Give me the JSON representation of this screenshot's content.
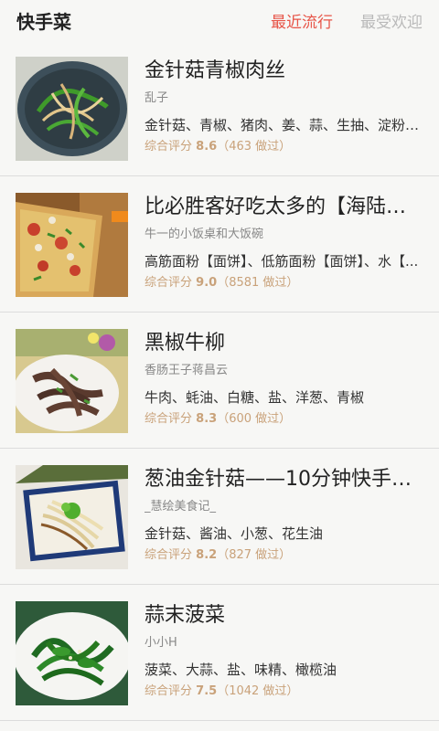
{
  "header": {
    "title": "快手菜",
    "tabs": [
      {
        "label": "最近流行",
        "active": true
      },
      {
        "label": "最受欢迎",
        "active": false
      }
    ]
  },
  "colors": {
    "accent": "#e75447",
    "rating": "#c9a27a",
    "inactive_tab": "#b9b9b9"
  },
  "recipes": [
    {
      "name": "金针菇青椒肉丝",
      "author": "乱子",
      "ingredients": "金针菇、青椒、猪肉、姜、蒜、生抽、淀粉、...",
      "rating_label": "综合评分",
      "score": "8.6",
      "count": "（463 做过）",
      "image": "stir-fry-enoki-pepper-pork"
    },
    {
      "name": "比必胜客好吃太多的【海陆至...",
      "author": "牛一的小饭桌和大饭碗",
      "ingredients": "高筋面粉【面饼】、低筋面粉【面饼】、水【...",
      "rating_label": "综合评分",
      "score": "9.0",
      "count": "（8581 做过）",
      "image": "seafood-pizza"
    },
    {
      "name": "黑椒牛柳",
      "author": "香肠王子蒋昌云",
      "ingredients": "牛肉、蚝油、白糖、盐、洋葱、青椒",
      "rating_label": "综合评分",
      "score": "8.3",
      "count": "（600 做过）",
      "image": "black-pepper-beef"
    },
    {
      "name": "葱油金针菇——10分钟快手菜...",
      "author": "_慧绘美食记_",
      "ingredients": "金针菇、酱油、小葱、花生油",
      "rating_label": "综合评分",
      "score": "8.2",
      "count": "（827 做过）",
      "image": "scallion-oil-enoki"
    },
    {
      "name": "蒜末菠菜",
      "author": "小小H",
      "ingredients": "菠菜、大蒜、盐、味精、橄榄油",
      "rating_label": "综合评分",
      "score": "7.5",
      "count": "（1042 做过）",
      "image": "garlic-spinach"
    }
  ]
}
